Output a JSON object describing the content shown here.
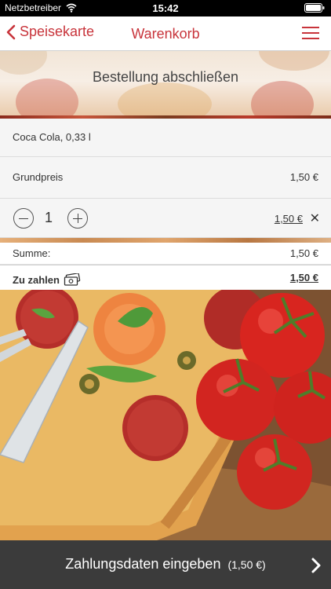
{
  "status_bar": {
    "carrier": "Netzbetreiber",
    "time": "15:42"
  },
  "nav": {
    "back_label": "Speisekarte",
    "title": "Warenkorb"
  },
  "banner": {
    "title": "Bestellung abschließen"
  },
  "item": {
    "name": "Coca Cola, 0,33 l"
  },
  "base_price": {
    "label": "Grundpreis",
    "value": "1,50 €"
  },
  "quantity": {
    "value": "1",
    "total": "1,50 €"
  },
  "summary": {
    "sum_label": "Summe:",
    "sum_value": "1,50 €",
    "pay_label": "Zu zahlen",
    "pay_value": "1,50 €"
  },
  "bottom": {
    "label": "Zahlungsdaten eingeben",
    "amount": "(1,50 €)"
  },
  "colors": {
    "accent": "#c8343b",
    "bottom_bar": "#3b3b3b"
  }
}
